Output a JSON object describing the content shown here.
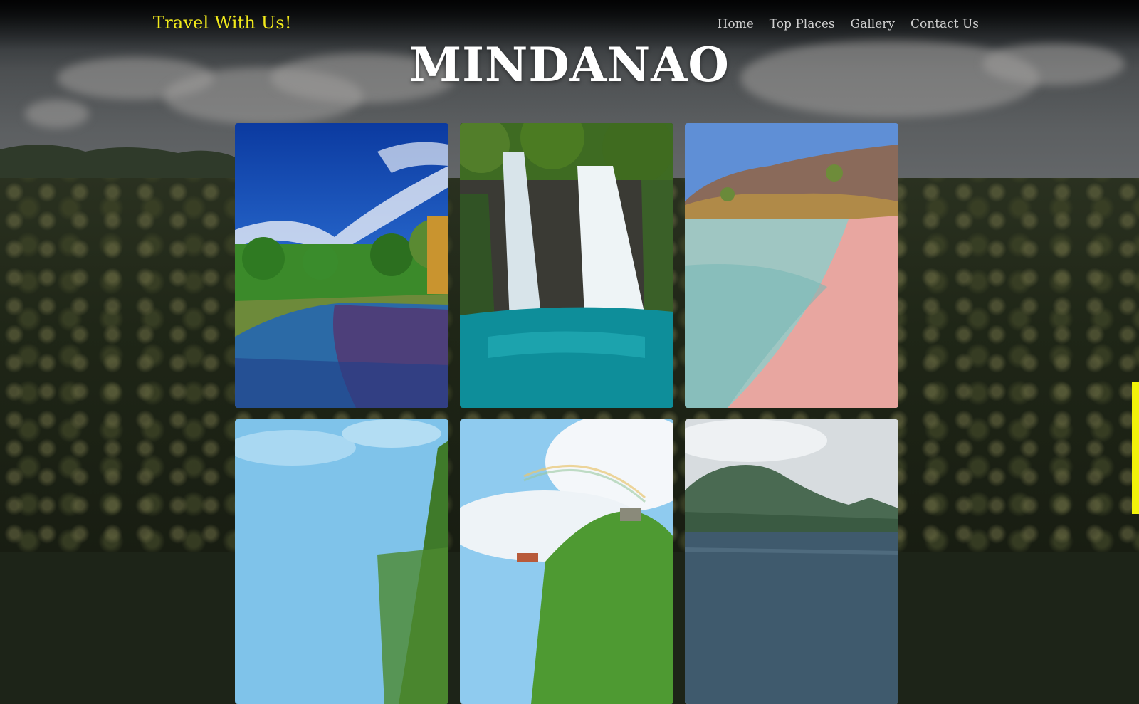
{
  "header": {
    "brand": "Travel With Us!",
    "nav": [
      "Home",
      "Top Places",
      "Gallery",
      "Contact Us"
    ]
  },
  "hero": {
    "title": "MINDANAO"
  },
  "gallery": {
    "photos": [
      {
        "name": "park-walkway"
      },
      {
        "name": "waterfall"
      },
      {
        "name": "pink-beach"
      },
      {
        "name": "tropical-shore"
      },
      {
        "name": "rainbow-mountain"
      },
      {
        "name": "volcano-lake"
      }
    ]
  },
  "colors": {
    "brand": "#f2ea1b",
    "nav": "#cfcfcf",
    "title": "#ffffff",
    "scrollbar": "#f2f20a"
  }
}
